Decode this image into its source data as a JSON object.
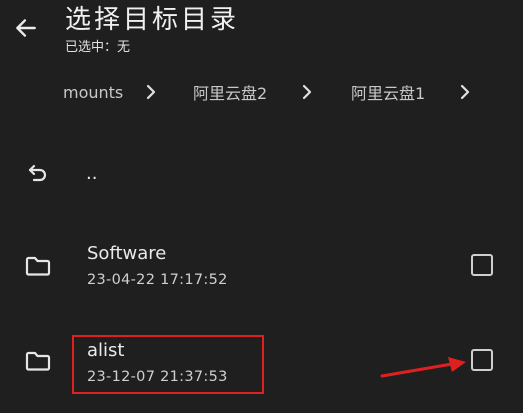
{
  "header": {
    "title": "选择目标目录",
    "selected_status": "已选中：无"
  },
  "breadcrumb": {
    "items": [
      {
        "label": "mounts"
      },
      {
        "label": "阿里云盘2"
      },
      {
        "label": "阿里云盘1"
      }
    ]
  },
  "parent_entry": {
    "label": ".."
  },
  "entries": [
    {
      "name": "Software",
      "date": "23-04-22 17:17:52",
      "checked": false
    },
    {
      "name": "alist",
      "date": "23-12-07 21:37:53",
      "checked": false
    }
  ],
  "colors": {
    "background": "#1f1f1f",
    "text": "#e9e9e9",
    "annotation": "#e02020"
  },
  "icons": {
    "back": "arrow-left-icon",
    "separator": "chevron-right-icon",
    "parent": "undo-icon",
    "folder": "folder-icon"
  }
}
